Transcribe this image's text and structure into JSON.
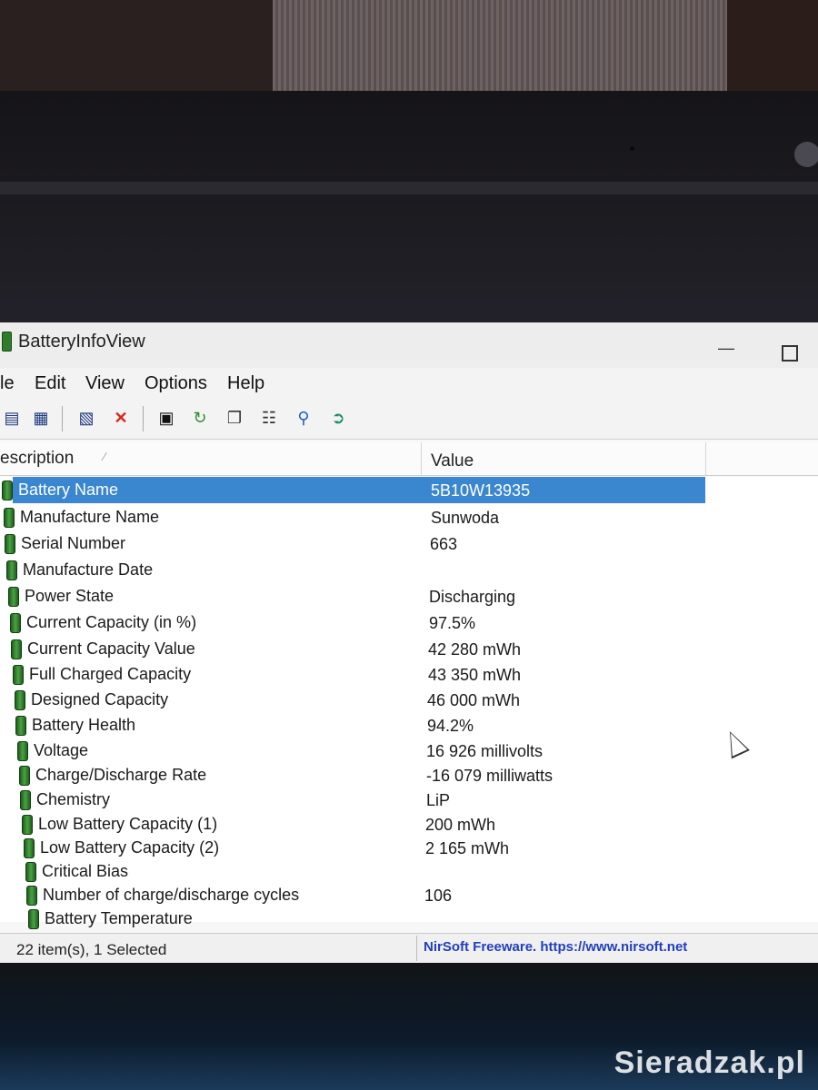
{
  "window": {
    "title": "BatteryInfoView"
  },
  "menu": [
    "le",
    "Edit",
    "View",
    "Options",
    "Help"
  ],
  "toolbar": {
    "icons": [
      "properties-icon",
      "copy-list-icon",
      "html-report-icon",
      "delete-icon",
      "save-icon",
      "refresh-icon",
      "copy-icon",
      "options-icon",
      "find-icon",
      "exit-icon"
    ]
  },
  "columns": {
    "description": "escription",
    "value": "Value"
  },
  "rows": [
    {
      "description": "Battery Name",
      "value": "5B10W13935",
      "selected": true
    },
    {
      "description": "Manufacture Name",
      "value": "Sunwoda"
    },
    {
      "description": "Serial Number",
      "value": "663"
    },
    {
      "description": "Manufacture Date",
      "value": ""
    },
    {
      "description": "Power State",
      "value": "Discharging"
    },
    {
      "description": "Current Capacity (in %)",
      "value": "97.5%"
    },
    {
      "description": "Current Capacity Value",
      "value": "42 280 mWh"
    },
    {
      "description": "Full Charged Capacity",
      "value": "43 350 mWh"
    },
    {
      "description": "Designed Capacity",
      "value": "46 000 mWh"
    },
    {
      "description": "Battery Health",
      "value": "94.2%"
    },
    {
      "description": "Voltage",
      "value": "16 926 millivolts"
    },
    {
      "description": "Charge/Discharge Rate",
      "value": "-16 079 milliwatts"
    },
    {
      "description": "Chemistry",
      "value": "LiP"
    },
    {
      "description": "Low Battery Capacity (1)",
      "value": "200 mWh"
    },
    {
      "description": "Low Battery Capacity (2)",
      "value": "2 165 mWh"
    },
    {
      "description": "Critical Bias",
      "value": ""
    },
    {
      "description": "Number of charge/discharge cycles",
      "value": "106"
    },
    {
      "description": "Battery Temperature",
      "value": ""
    }
  ],
  "status": {
    "items": "22 item(s), 1 Selected",
    "credit": "NirSoft Freeware. https://www.nirsoft.net"
  },
  "watermark": "Sieradzak.pl",
  "colors": {
    "selection": "#3a86cf",
    "battery_icon": "#2f7d2c",
    "credit_link": "#1f3fbf"
  }
}
